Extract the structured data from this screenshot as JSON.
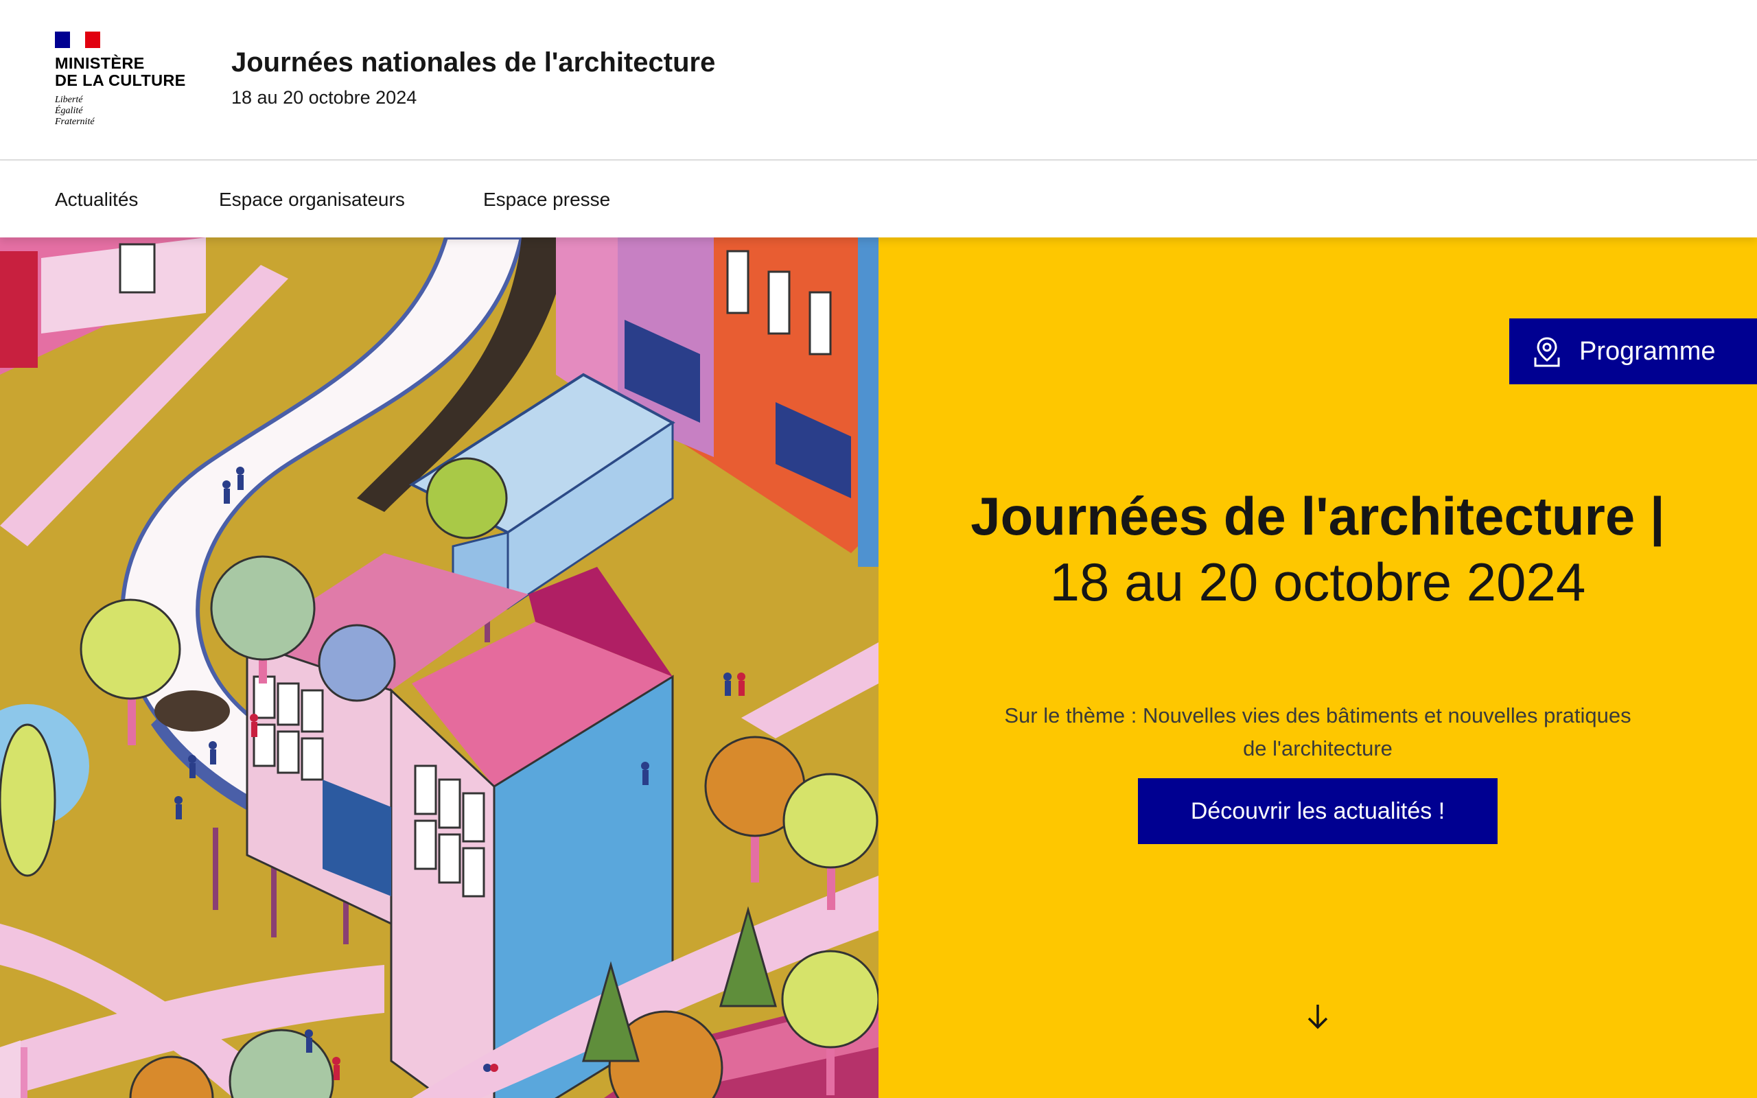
{
  "header": {
    "logo": {
      "title": "MINISTÈRE\nDE LA CULTURE",
      "motto": "Liberté\nÉgalité\nFraternité"
    },
    "site_title": "Journées nationales de l'architecture",
    "tagline": "18 au 20 octobre 2024"
  },
  "nav": {
    "items": [
      {
        "label": "Actualités"
      },
      {
        "label": "Espace organisateurs"
      },
      {
        "label": "Espace presse"
      }
    ]
  },
  "hero": {
    "programme_button": {
      "label": "Programme",
      "icon": "map-pin-icon"
    },
    "heading_strong": "Journées de l'architecture |",
    "heading_light": "18 au 20 octobre 2024",
    "subtitle": "Sur le thème : Nouvelles vies des bâtiments et nouvelles pratiques de l'architecture",
    "cta_label": "Découvrir les actualités !",
    "scroll_icon": "arrow-down-icon"
  },
  "colors": {
    "brand_blue": "#000091",
    "hero_yellow": "#fec700",
    "flag_blue": "#000091",
    "flag_red": "#e1000f",
    "text": "#161616"
  }
}
